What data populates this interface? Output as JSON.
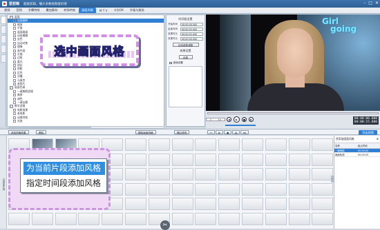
{
  "window": {
    "app_name": "爱剪辑",
    "subtitle": "超级剪辑，懂大多数视频爱好者",
    "controls": [
      "–",
      "□",
      "✕"
    ]
  },
  "tabs": [
    {
      "label": "视频",
      "active": false
    },
    {
      "label": "音频",
      "active": false
    },
    {
      "label": "字幕特效",
      "active": false
    },
    {
      "label": "叠加素材",
      "active": false
    },
    {
      "label": "转场特效",
      "active": false
    },
    {
      "label": "画面风格",
      "active": true
    },
    {
      "label": "M T V",
      "active": false
    },
    {
      "label": "卡拉OK",
      "active": false
    },
    {
      "label": "升级与服务",
      "active": false
    }
  ],
  "style_list": [
    {
      "label": "画面",
      "type": "cat"
    },
    {
      "label": "自由旋转",
      "type": "sel"
    },
    {
      "label": "缩放",
      "type": "item"
    },
    {
      "label": "平移",
      "type": "item"
    },
    {
      "label": "画面微调",
      "type": "item"
    },
    {
      "label": "动态模糊",
      "type": "item"
    },
    {
      "label": "去色",
      "type": "item"
    },
    {
      "label": "自动对焦",
      "type": "item"
    },
    {
      "label": "镜像",
      "type": "item"
    },
    {
      "label": "画中画",
      "type": "item"
    },
    {
      "label": "分镜",
      "type": "item"
    },
    {
      "label": "边框",
      "type": "item"
    },
    {
      "label": "柔光",
      "type": "item"
    },
    {
      "label": "锐化",
      "type": "item"
    },
    {
      "label": "阴影",
      "type": "item"
    },
    {
      "label": "反色",
      "type": "item"
    },
    {
      "label": "浮雕",
      "type": "item"
    },
    {
      "label": "马赛克",
      "type": "item"
    },
    {
      "label": "老照片",
      "type": "item"
    },
    {
      "label": "画面色调",
      "type": "cat"
    },
    {
      "label": "一键美颜滤镜",
      "type": "item"
    },
    {
      "label": "美肤",
      "type": "item"
    },
    {
      "label": "调色",
      "type": "item"
    },
    {
      "label": "一键去雾",
      "type": "item"
    },
    {
      "label": "数字滤镜",
      "type": "cat"
    },
    {
      "label": "电影效果",
      "type": "item"
    },
    {
      "label": "老电影",
      "type": "item"
    },
    {
      "label": "动景特效",
      "type": "item"
    },
    {
      "label": "光效",
      "type": "item"
    }
  ],
  "params": {
    "title": "时间段设置",
    "rows": [
      {
        "label": "开始时间",
        "value": "00:00:00.000"
      },
      {
        "label": "结束时间",
        "value": "00:00:05.000"
      },
      {
        "label": "效果时长",
        "value": "00:00:05.000"
      },
      {
        "label": "效果时长",
        "value": "00:00:00.000"
      }
    ],
    "apply_button": "应用参数调整",
    "effect_label": "效果设置",
    "reset_label": "还原",
    "checkbox_label": "逐帧设置",
    "confirm_button": "确认修改"
  },
  "preview": {
    "overlay_line1": "Girl",
    "overlay_line2": "going"
  },
  "player": {
    "time_mode": "∕∕",
    "speed": "1×",
    "current_time": "00:00:00.000",
    "total_time": "00:00:15.880"
  },
  "toolbar": {
    "add_style": "添加风格效果",
    "delete": "删除",
    "delete_style": "删除画面风格",
    "confirm": "确认修改",
    "export": "导出视频"
  },
  "timeline": {
    "side_label": "已添加片段"
  },
  "added_styles": {
    "title": "所添加画面风格",
    "columns": [
      "名称",
      "起止时间"
    ],
    "rows": [
      {
        "name": "一键美颜",
        "time": "00:00:00",
        "selected": true
      },
      {
        "name": "画面色调",
        "time": "00:00:05",
        "selected": false
      }
    ]
  },
  "callout_top": {
    "text": "选中画面风格"
  },
  "context_menu": {
    "options": [
      "为当前片段添加风格",
      "指定时间段添加风格"
    ],
    "highlighted": 0
  }
}
